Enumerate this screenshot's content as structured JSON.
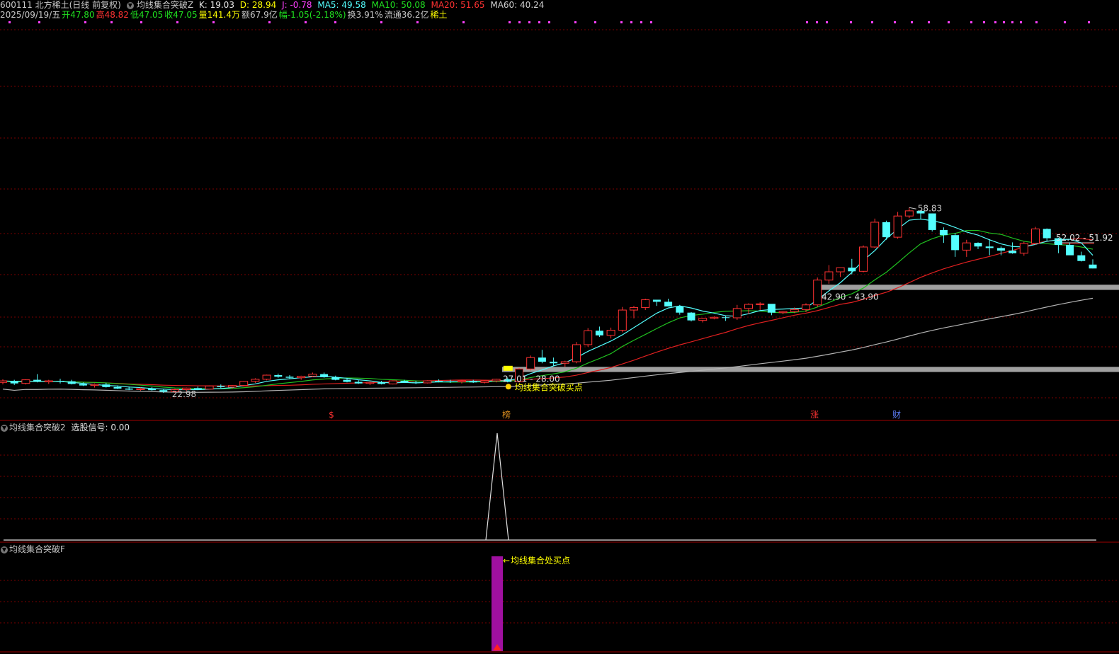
{
  "header": {
    "line1": {
      "stock": "600111 北方稀土(日线 前复权)",
      "indicator": "均线集合突破Z",
      "k": "K: 19.03",
      "d": "D: 28.94",
      "j": "J: -0.78",
      "ma5": "MA5: 49.58",
      "ma10": "MA10: 50.08",
      "ma20": "MA20: 51.65",
      "ma60": "MA60: 40.24"
    },
    "line2": {
      "date": "2025/09/19/五",
      "open": "开47.80",
      "high": "高48.82",
      "low": "低47.05",
      "close": "收47.05",
      "volume": "量141.4万",
      "amount": "额67.9亿",
      "change": "幅-1.05(-2.18%)",
      "turnover": "换3.91%",
      "float": "流通36.2亿",
      "sector": "稀土"
    }
  },
  "colors": {
    "up": "#ff3232",
    "down": "#54ffff",
    "ma5": "#54ffff",
    "ma10": "#20c020",
    "ma20": "#e02020",
    "ma60": "#b4b4b4",
    "grid": "#7a0000",
    "band": "#a0a0a0",
    "signal": "#ffff00",
    "bar": "#a010a0"
  },
  "annotations": {
    "high": "58.83",
    "low": "22.98",
    "zone_low": "27.01 - 28.00",
    "zone_mid": "42.90 - 43.90",
    "zone_high": "52.02 - 51.92",
    "buy_point": "均线集合突破买点",
    "markers": [
      "$",
      "榜",
      "涨",
      "财"
    ]
  },
  "panel2": {
    "title": "均线集合突破2",
    "signal_label": "选股信号: 0.00"
  },
  "panel3": {
    "title": "均线集合突破F",
    "label": "均线集合处买点"
  },
  "chart_data": {
    "type": "candlestick",
    "ohlc": [
      [
        25.0,
        25.6,
        24.6,
        25.3
      ],
      [
        25.3,
        25.5,
        24.5,
        24.8
      ],
      [
        24.8,
        25.6,
        24.6,
        25.5
      ],
      [
        25.5,
        26.6,
        25.0,
        25.1
      ],
      [
        25.1,
        25.5,
        24.7,
        25.3
      ],
      [
        25.3,
        25.7,
        24.8,
        25.2
      ],
      [
        25.2,
        25.5,
        24.6,
        24.7
      ],
      [
        24.7,
        25.0,
        24.3,
        24.4
      ],
      [
        24.4,
        24.8,
        24.0,
        24.6
      ],
      [
        24.6,
        24.9,
        24.0,
        24.1
      ],
      [
        24.1,
        24.4,
        23.7,
        23.8
      ],
      [
        23.8,
        24.2,
        23.5,
        23.6
      ],
      [
        23.6,
        24.0,
        23.4,
        23.8
      ],
      [
        23.8,
        24.1,
        23.4,
        23.5
      ],
      [
        23.5,
        23.7,
        22.98,
        23.2
      ],
      [
        23.2,
        23.8,
        23.0,
        23.6
      ],
      [
        23.6,
        24.0,
        23.3,
        23.9
      ],
      [
        23.9,
        24.2,
        23.5,
        23.7
      ],
      [
        23.7,
        24.4,
        23.6,
        24.3
      ],
      [
        24.3,
        24.6,
        23.9,
        24.1
      ],
      [
        24.1,
        24.5,
        23.8,
        24.4
      ],
      [
        24.4,
        25.3,
        24.2,
        25.2
      ],
      [
        25.2,
        25.8,
        24.9,
        25.6
      ],
      [
        25.6,
        26.5,
        25.4,
        26.4
      ],
      [
        26.4,
        26.7,
        25.9,
        26.1
      ],
      [
        26.1,
        26.4,
        25.7,
        25.9
      ],
      [
        25.9,
        26.3,
        25.5,
        26.2
      ],
      [
        26.2,
        26.9,
        26.0,
        26.6
      ],
      [
        26.6,
        26.9,
        25.9,
        26.0
      ],
      [
        26.0,
        26.3,
        25.4,
        25.5
      ],
      [
        25.5,
        25.8,
        25.0,
        25.1
      ],
      [
        25.1,
        25.4,
        24.7,
        24.8
      ],
      [
        24.8,
        25.2,
        24.5,
        25.0
      ],
      [
        25.0,
        25.3,
        24.6,
        24.7
      ],
      [
        24.7,
        25.4,
        24.6,
        25.3
      ],
      [
        25.3,
        25.5,
        24.9,
        25.0
      ],
      [
        25.0,
        25.3,
        24.7,
        24.9
      ],
      [
        24.9,
        25.4,
        24.8,
        25.3
      ],
      [
        25.3,
        25.6,
        25.0,
        25.2
      ],
      [
        25.2,
        25.5,
        24.9,
        25.1
      ],
      [
        25.1,
        25.4,
        24.8,
        25.3
      ],
      [
        25.3,
        25.5,
        24.9,
        25.0
      ],
      [
        25.0,
        25.4,
        24.8,
        25.3
      ],
      [
        25.3,
        25.7,
        25.0,
        25.6
      ],
      [
        25.6,
        25.9,
        25.0,
        25.1
      ],
      [
        25.1,
        27.8,
        25.0,
        27.6
      ],
      [
        27.6,
        30.2,
        27.3,
        29.8
      ],
      [
        29.8,
        31.3,
        28.7,
        29.0
      ],
      [
        29.0,
        29.8,
        28.2,
        28.7
      ],
      [
        28.7,
        29.2,
        28.0,
        29.0
      ],
      [
        29.0,
        32.8,
        28.7,
        32.3
      ],
      [
        32.3,
        35.5,
        31.9,
        35.0
      ],
      [
        35.0,
        35.8,
        33.8,
        34.1
      ],
      [
        34.1,
        35.6,
        33.5,
        35.1
      ],
      [
        35.1,
        39.6,
        34.7,
        39.0
      ],
      [
        39.0,
        39.8,
        37.4,
        39.5
      ],
      [
        39.5,
        41.2,
        39.0,
        41.0
      ],
      [
        41.0,
        40.8,
        39.8,
        40.6
      ],
      [
        40.6,
        41.2,
        39.8,
        39.7
      ],
      [
        39.7,
        40.0,
        38.1,
        38.5
      ],
      [
        38.5,
        38.6,
        36.8,
        37.0
      ],
      [
        37.0,
        37.5,
        36.6,
        37.4
      ],
      [
        37.4,
        37.8,
        37.2,
        37.6
      ],
      [
        37.6,
        37.9,
        36.9,
        37.5
      ],
      [
        37.5,
        40.0,
        37.1,
        39.3
      ],
      [
        39.3,
        40.3,
        38.2,
        40.1
      ],
      [
        40.1,
        40.5,
        39.0,
        40.2
      ],
      [
        40.2,
        40.0,
        38.0,
        38.5
      ],
      [
        38.5,
        38.8,
        38.2,
        38.7
      ],
      [
        38.7,
        39.5,
        38.4,
        39.1
      ],
      [
        39.1,
        40.3,
        38.6,
        40.0
      ],
      [
        40.0,
        45.3,
        39.6,
        44.8
      ],
      [
        44.8,
        47.7,
        44.1,
        46.4
      ],
      [
        46.4,
        47.2,
        45.4,
        47.2
      ],
      [
        47.2,
        48.9,
        45.9,
        46.5
      ],
      [
        46.5,
        51.5,
        46.3,
        51.2
      ],
      [
        51.2,
        56.7,
        51.0,
        56.0
      ],
      [
        56.0,
        56.3,
        52.6,
        53.1
      ],
      [
        53.1,
        58.0,
        52.8,
        57.2
      ],
      [
        57.2,
        58.83,
        56.8,
        58.2
      ],
      [
        58.2,
        58.3,
        56.6,
        57.7
      ],
      [
        57.7,
        57.7,
        54.2,
        54.5
      ],
      [
        54.5,
        55.0,
        52.0,
        53.5
      ],
      [
        53.5,
        53.9,
        49.3,
        50.6
      ],
      [
        50.6,
        52.6,
        49.3,
        52.0
      ],
      [
        52.0,
        52.1,
        50.8,
        51.3
      ],
      [
        51.3,
        52.7,
        49.6,
        51.0
      ],
      [
        51.0,
        51.3,
        49.6,
        50.5
      ],
      [
        50.5,
        52.1,
        49.9,
        50.0
      ],
      [
        50.0,
        52.2,
        49.5,
        51.9
      ],
      [
        51.9,
        55.1,
        51.6,
        54.7
      ],
      [
        54.7,
        54.8,
        52.4,
        52.9
      ],
      [
        52.9,
        53.0,
        50.0,
        51.6
      ],
      [
        51.6,
        52.1,
        49.7,
        49.6
      ],
      [
        49.6,
        50.3,
        48.4,
        48.5
      ],
      [
        47.8,
        48.82,
        47.05,
        47.05
      ]
    ],
    "ma5": [
      25.3,
      25.2,
      25.2,
      25.2,
      25.2,
      25.2,
      25.0,
      24.8,
      24.6,
      24.4,
      24.3,
      24.1,
      24.0,
      23.8,
      23.7,
      23.6,
      23.6,
      23.6,
      23.7,
      23.8,
      24.0,
      24.4,
      24.7,
      25.2,
      25.5,
      25.7,
      25.9,
      26.1,
      26.2,
      26.0,
      25.8,
      25.5,
      25.3,
      25.0,
      24.9,
      25.0,
      24.9,
      25.0,
      25.1,
      25.1,
      25.2,
      25.2,
      25.2,
      25.3,
      25.3,
      25.8,
      26.7,
      27.4,
      28.2,
      28.8,
      29.8,
      31.0,
      32.0,
      33.0,
      34.2,
      35.6,
      37.0,
      38.4,
      39.4,
      39.8,
      39.4,
      38.8,
      38.4,
      37.9,
      37.8,
      38.3,
      38.9,
      39.1,
      39.2,
      39.3,
      39.4,
      41.0,
      42.7,
      44.3,
      46.3,
      48.6,
      50.5,
      52.8,
      54.7,
      56.4,
      56.6,
      56.3,
      55.8,
      55.0,
      54.1,
      53.5,
      52.6,
      51.8,
      51.3,
      51.2,
      51.7,
      52.3,
      52.6,
      52.7,
      52.0,
      49.6
    ]
  }
}
